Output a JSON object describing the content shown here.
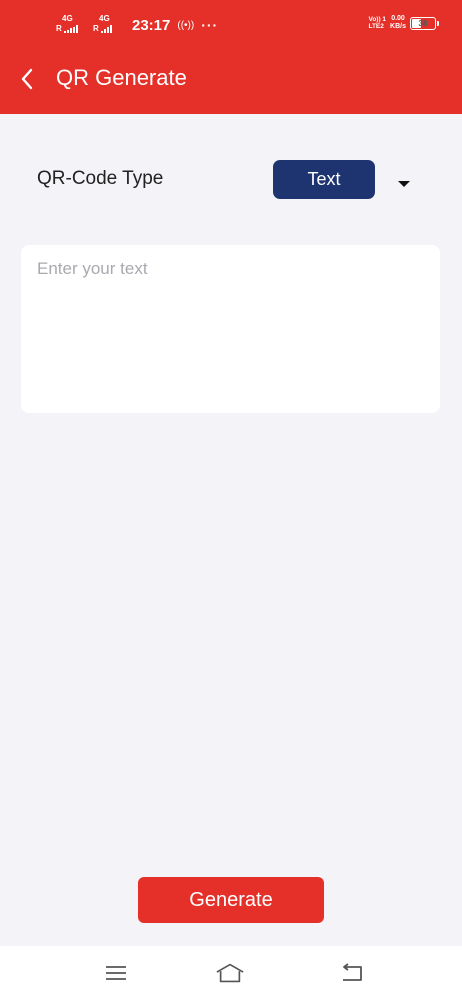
{
  "status_bar": {
    "sim1_network": "4G",
    "sim1_roaming": "R",
    "sim2_network": "4G",
    "sim2_roaming": "R",
    "time": "23:17",
    "more": "···",
    "volte_top": "Vo)) 1",
    "volte_bottom": "LTE2",
    "speed_value": "0.00",
    "speed_unit": "KB/s",
    "battery_level": "38"
  },
  "app_bar": {
    "title": "QR Generate",
    "back_icon": "chevron-left-icon"
  },
  "qr_type": {
    "label": "QR-Code Type",
    "selected": "Text",
    "dropdown_icon": "caret-down-icon"
  },
  "text_input": {
    "value": "",
    "placeholder": "Enter your text"
  },
  "generate_button": {
    "label": "Generate"
  },
  "nav_bar": {
    "menu_icon": "menu-icon",
    "home_icon": "home-icon",
    "back_icon": "back-icon"
  },
  "colors": {
    "primary": "#e5302a",
    "type_button": "#1e3470",
    "background": "#f4f3f8"
  }
}
